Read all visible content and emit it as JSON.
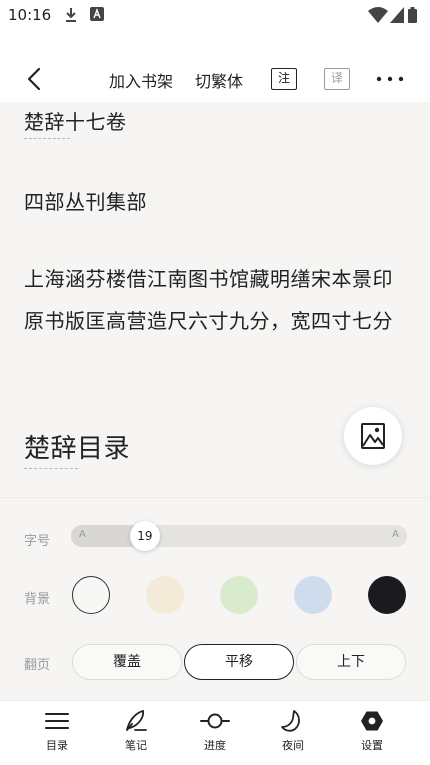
{
  "status": {
    "time": "10:16"
  },
  "toolbar": {
    "add_shelf": "加入书架",
    "convert": "切繁体",
    "note_tag": "注",
    "translate_tag": "译"
  },
  "content": {
    "heading1": "楚辞十七卷",
    "para1": "四部丛刊集部",
    "para2": "上海涵芬楼借江南图书馆藏明缮宋本景印原书版匡高营造尺六寸九分，宽四寸七分",
    "heading2": "楚辞目录"
  },
  "settings": {
    "font_label": "字号",
    "font_min": "A",
    "font_max": "A",
    "font_value": "19",
    "font_fraction": 0.22,
    "bg_label": "背景",
    "bg_colors": [
      "#f7f7f5",
      "#f3ead7",
      "#d8ebcc",
      "#cfdcee",
      "#1b1b1f"
    ],
    "page_label": "翻页",
    "page_modes": [
      "覆盖",
      "平移",
      "上下"
    ]
  },
  "nav": {
    "items": [
      {
        "label": "目录",
        "icon": "list-icon"
      },
      {
        "label": "笔记",
        "icon": "pen-icon"
      },
      {
        "label": "进度",
        "icon": "progress-icon"
      },
      {
        "label": "夜间",
        "icon": "moon-icon"
      },
      {
        "label": "设置",
        "icon": "settings-icon"
      }
    ]
  }
}
